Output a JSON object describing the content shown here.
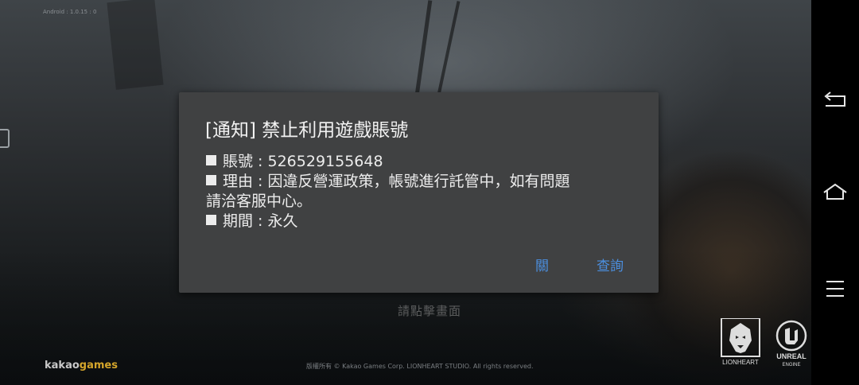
{
  "screen": {
    "version_text": "Android : 1.0.15 : 0",
    "tap_hint": "請點擊畫面"
  },
  "dialog": {
    "title": "[通知] 禁止利用遊戲賬號",
    "account_label": "賬號",
    "account_value": "526529155648",
    "reason_label": "理由",
    "reason_line1": "因違反營運政策，帳號進行託管中，如有問題",
    "reason_line2": "請洽客服中心。",
    "period_label": "期間",
    "period_value": "永久",
    "separator": " : ",
    "close_label": "關",
    "inquire_label": "查詢",
    "button_color": "#4b8fe0"
  },
  "footer": {
    "kakao_prefix": "kakao",
    "kakao_suffix": "games",
    "copyright": "版權所有 © Kakao Games Corp. LIONHEART STUDIO. All rights reserved.",
    "lionheart_text": "LIONHEART",
    "unreal_line1": "UNREAL",
    "unreal_line2": "ENGINE"
  },
  "navbar": {
    "icons": [
      "back-icon",
      "home-icon",
      "menu-icon"
    ]
  }
}
